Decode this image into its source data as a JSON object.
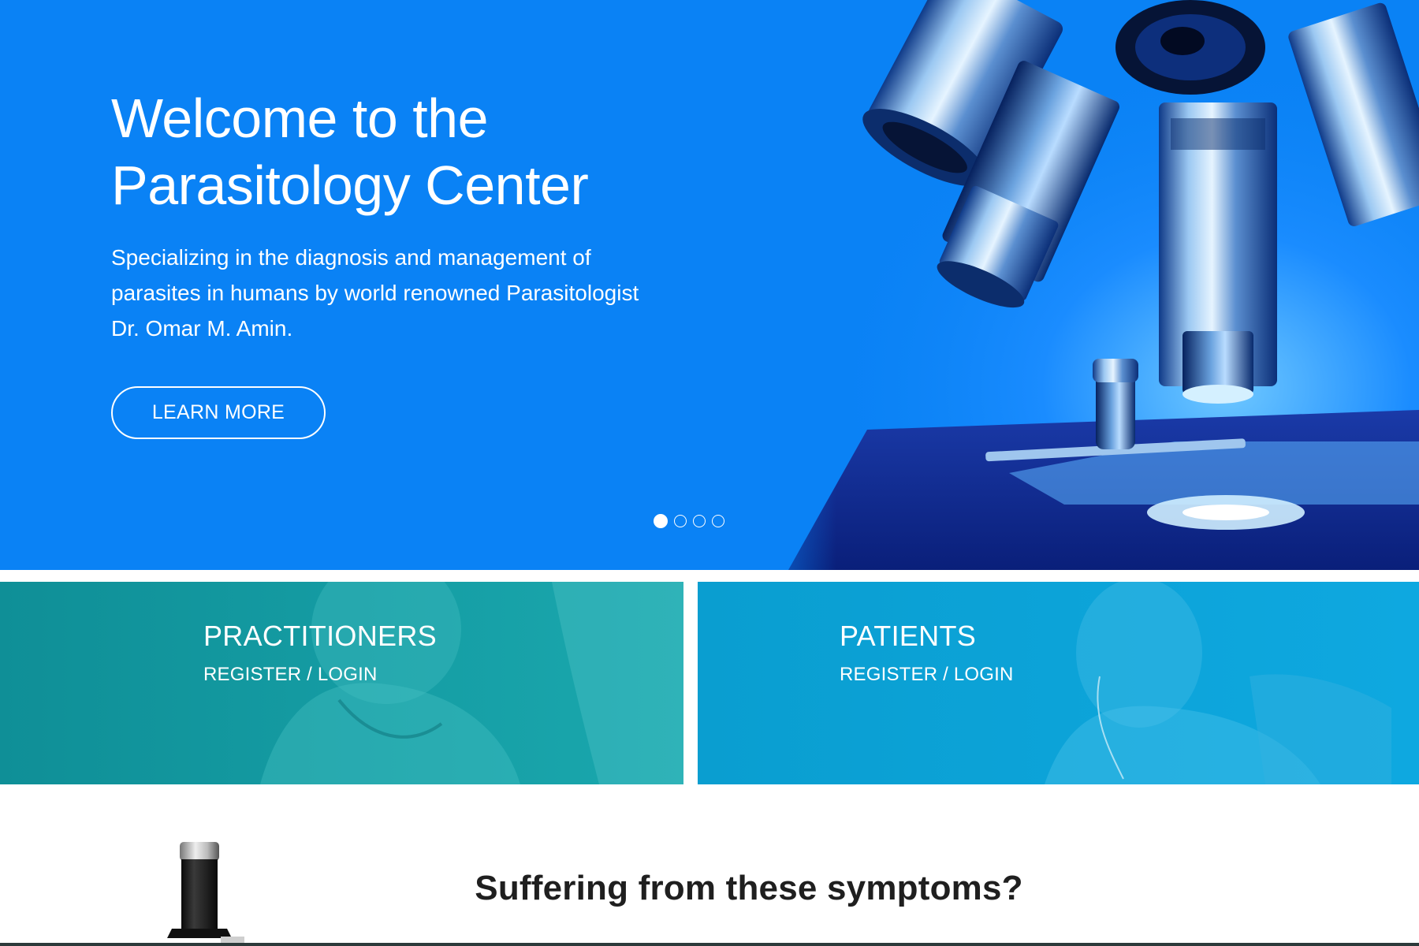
{
  "hero": {
    "title_line1": "Welcome to the",
    "title_line2": "Parasitology Center",
    "subtitle": "Specializing in the diagnosis and management of parasites in humans by world renowned Parasitologist Dr. Omar M. Amin.",
    "button_label": "LEARN MORE",
    "image_icon": "microscope-image",
    "slides": {
      "count": 4,
      "active": 1
    },
    "background_color": "#0a82f5"
  },
  "cards": {
    "practitioners": {
      "title": "PRACTITIONERS",
      "link": "REGISTER / LOGIN",
      "color": "#129ba5"
    },
    "patients": {
      "title": "PATIENTS",
      "link": "REGISTER / LOGIN",
      "color": "#0aa1d2"
    }
  },
  "symptoms": {
    "title": "Suffering from these symptoms?"
  }
}
